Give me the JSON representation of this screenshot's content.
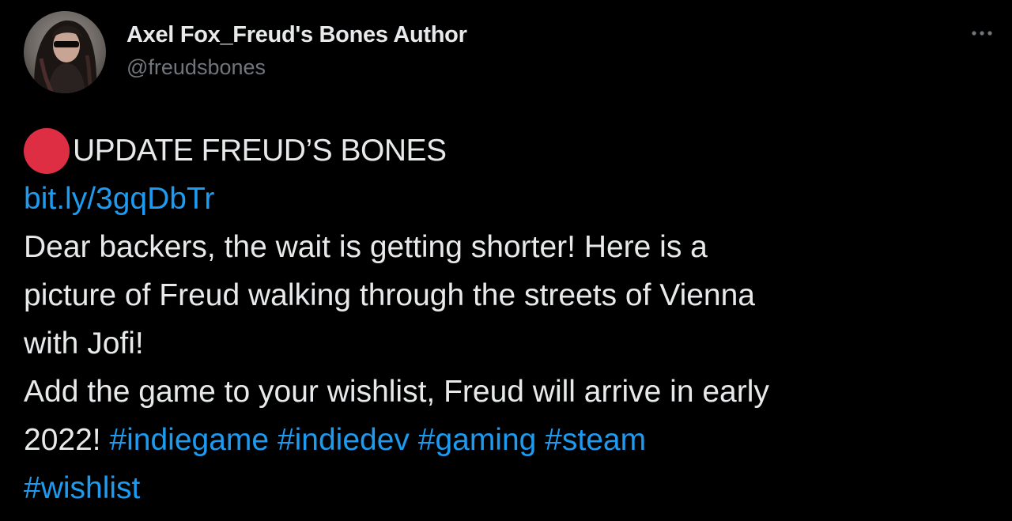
{
  "author": {
    "display_name": "Axel Fox_Freud's Bones Author",
    "handle": "@freudsbones"
  },
  "more_icon": "ellipsis-icon",
  "colors": {
    "background": "#000000",
    "text": "#e7e9ea",
    "secondary_text": "#71767b",
    "link": "#1d9bf0",
    "red_circle": "#dd2e44"
  },
  "tweet": {
    "emoji_icon": "red-circle-icon",
    "headline": "UPDATE FREUD’S BONES",
    "link": "bit.ly/3gqDbTr",
    "lines": [
      "Dear backers, the wait is getting shorter! Here is a",
      "picture of Freud walking through the streets of Vienna",
      "with Jofi!",
      "Add the game to your wishlist, Freud will arrive in early"
    ],
    "last_line_text": "2022! ",
    "hashtags": [
      "#indiegame",
      "#indiedev",
      "#gaming",
      "#steam",
      "#wishlist"
    ]
  }
}
